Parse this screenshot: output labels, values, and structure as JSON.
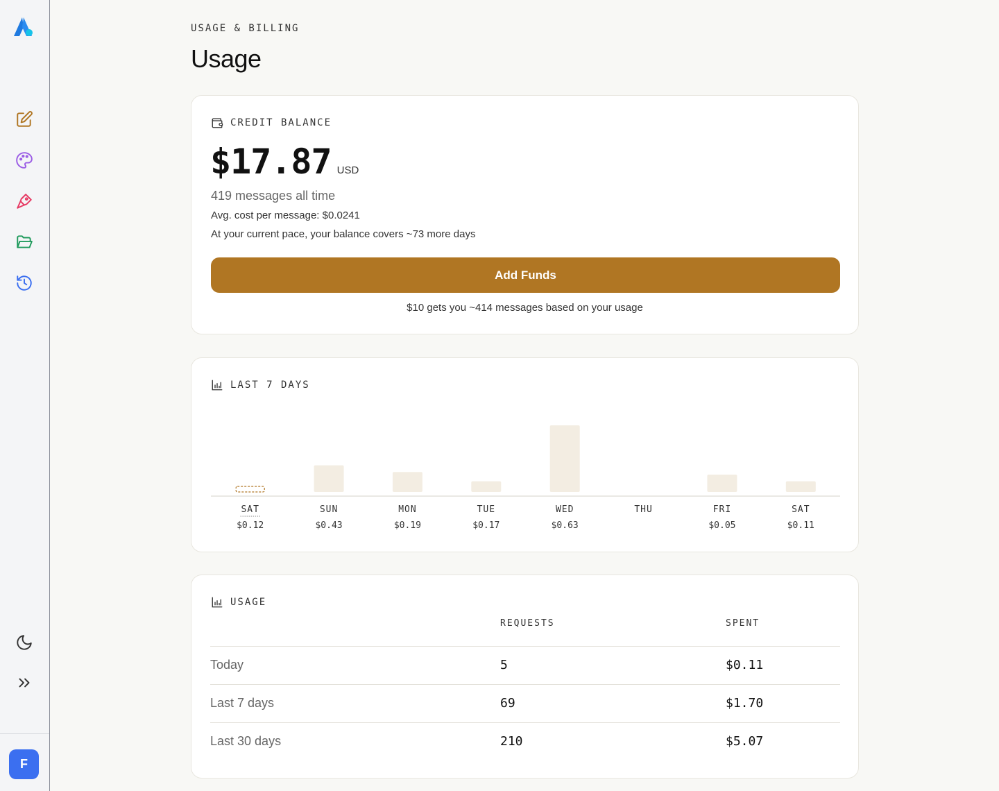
{
  "sidebar": {
    "nav": [
      {
        "name": "edit",
        "color": "#b07623"
      },
      {
        "name": "palette",
        "color": "#9b5de5"
      },
      {
        "name": "pen",
        "color": "#e63963"
      },
      {
        "name": "folder",
        "color": "#1f9a5c"
      },
      {
        "name": "history",
        "color": "#3b6ff0"
      }
    ],
    "avatar_initial": "F"
  },
  "header": {
    "eyebrow": "USAGE & BILLING",
    "title": "Usage"
  },
  "credit": {
    "heading": "CREDIT BALANCE",
    "amount": "$17.87",
    "currency": "USD",
    "messages": "419 messages all time",
    "avg_cost": "Avg. cost per message: $0.0241",
    "pace": "At your current pace, your balance covers ~73 more days",
    "button": "Add Funds",
    "hint": "$10 gets you ~414 messages based on your usage",
    "accent": "#b07623"
  },
  "last7": {
    "heading": "LAST 7 DAYS"
  },
  "chart_data": {
    "type": "bar",
    "categories": [
      "SAT",
      "SUN",
      "MON",
      "TUE",
      "WED",
      "THU",
      "FRI",
      "SAT"
    ],
    "values": [
      0.12,
      0.43,
      0.19,
      0.17,
      0.63,
      0,
      0.05,
      0.11
    ],
    "value_labels": [
      "$0.12",
      "$0.43",
      "$0.19",
      "$0.17",
      "$0.63",
      "",
      "$0.05",
      "$0.11"
    ],
    "bar_heights": [
      0.02,
      0.4,
      0.3,
      0.16,
      1.0,
      0,
      0.26,
      0.16
    ],
    "highlighted_index": 0,
    "bar_color": "#f3ede2",
    "highlight_color": "#b07623",
    "grid": false,
    "title": "LAST 7 DAYS"
  },
  "usage": {
    "heading": "USAGE",
    "columns": [
      "",
      "REQUESTS",
      "SPENT"
    ],
    "rows": [
      {
        "label": "Today",
        "requests": "5",
        "spent": "$0.11"
      },
      {
        "label": "Last 7 days",
        "requests": "69",
        "spent": "$1.70"
      },
      {
        "label": "Last 30 days",
        "requests": "210",
        "spent": "$5.07"
      }
    ]
  }
}
